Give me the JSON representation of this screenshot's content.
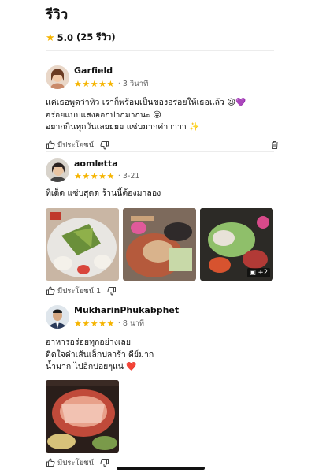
{
  "page": {
    "title": "รีวิว",
    "rating": "5.0",
    "review_count": "(25 รีวิว)"
  },
  "reviews": [
    {
      "author": "Garfield",
      "stars": "★★★★★",
      "time": "3 วินาที",
      "text": "แค่เธอพูดว่าหิว เราก็พร้อมเป็นของอร่อยให้เธอแล้ว 😉💜\nอร่อยแบบแสงออกปากมากนะ 😛\nอยากกินทุกวันเลยยยย แซ่บมากค่าาาาา ✨",
      "helpful_label": "มีประโยชน์",
      "helpful_count": ""
    },
    {
      "author": "aomletta",
      "stars": "★★★★★",
      "time": "3-21",
      "text": "ทีเด็ด แซ่บสุดด ร้านนี้ต้องมาลอง",
      "helpful_label": "มีประโยชน์",
      "helpful_count": "1",
      "more_photos": "+2"
    },
    {
      "author": "MukharinPhukabphet",
      "stars": "★★★★★",
      "time": "8 นาที",
      "text": "อาหารอร่อยทุกอย่างเลย\nติดใจดำเส้นเล็กปลาร้า ดีย์มาก\nน้ำมาก ไปอีกบ่อยๆแน่ ❤️",
      "helpful_label": "มีประโยชน์",
      "helpful_count": ""
    }
  ],
  "icons": {
    "star": "star-icon",
    "like": "thumbs-up-icon",
    "dislike": "thumbs-down-icon",
    "delete": "trash-icon",
    "gallery": "image-stack-icon"
  },
  "colors": {
    "star": "#f5b400",
    "text": "#111111",
    "muted": "#666666"
  }
}
